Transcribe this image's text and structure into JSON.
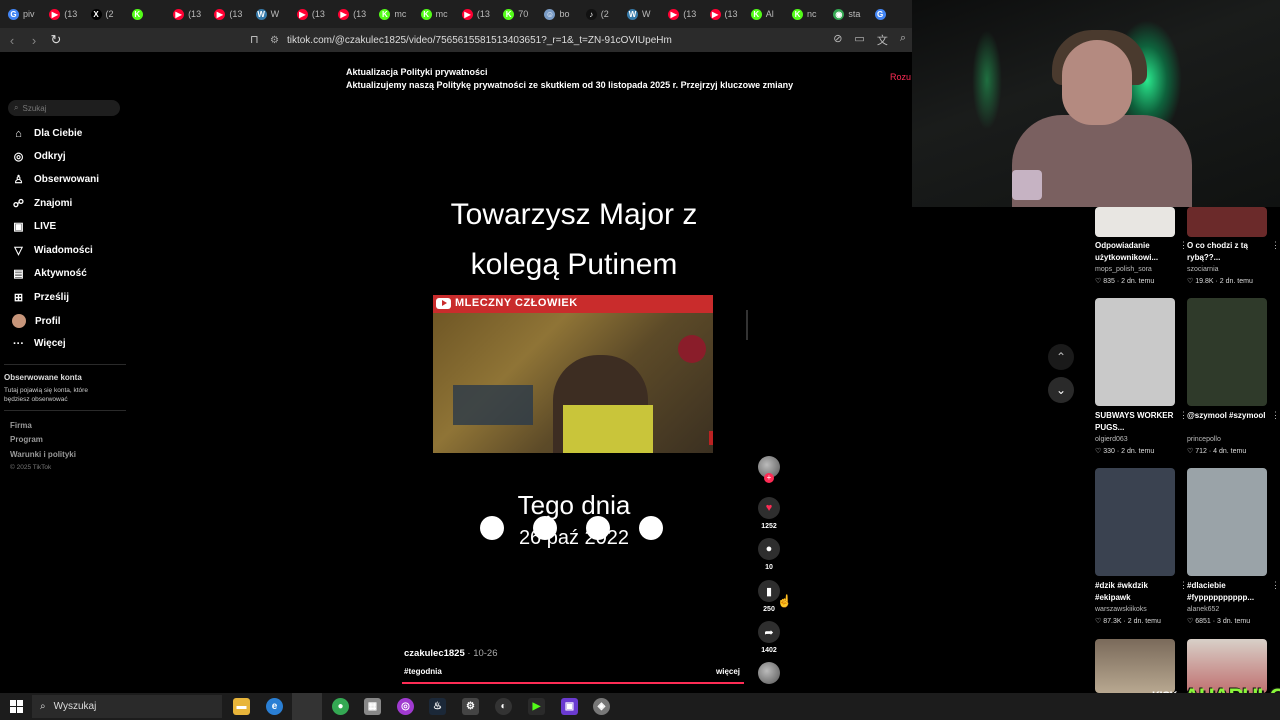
{
  "browser": {
    "tabs": [
      {
        "icon": "google-icon",
        "label": "piv",
        "color": "#4285f4",
        "glyph": "G"
      },
      {
        "icon": "youtube-icon",
        "label": "(13",
        "color": "#ff0033",
        "glyph": "▶"
      },
      {
        "icon": "x-icon",
        "label": "(2",
        "color": "#000000",
        "glyph": "X"
      },
      {
        "icon": "kick-icon",
        "label": "",
        "color": "#53fc18",
        "glyph": "K"
      },
      {
        "icon": "youtube-icon",
        "label": "(13",
        "color": "#ff0033",
        "glyph": "▶"
      },
      {
        "icon": "youtube-icon",
        "label": "(13",
        "color": "#ff0033",
        "glyph": "▶"
      },
      {
        "icon": "wykop-icon",
        "label": "W",
        "color": "#367aa9",
        "glyph": "W"
      },
      {
        "icon": "youtube-icon",
        "label": "(13",
        "color": "#ff0033",
        "glyph": "▶"
      },
      {
        "icon": "youtube-icon",
        "label": "(13",
        "color": "#ff0033",
        "glyph": "▶"
      },
      {
        "icon": "kick-icon",
        "label": "mc",
        "color": "#53fc18",
        "glyph": "K"
      },
      {
        "icon": "kick-icon",
        "label": "mc",
        "color": "#53fc18",
        "glyph": "K"
      },
      {
        "icon": "youtube-icon",
        "label": "(13",
        "color": "#ff0033",
        "glyph": "▶"
      },
      {
        "icon": "kick-icon",
        "label": "70",
        "color": "#53fc18",
        "glyph": "K"
      },
      {
        "icon": "bot-icon",
        "label": "bo",
        "color": "#7a9cc6",
        "glyph": "☺"
      },
      {
        "icon": "tiktok-icon",
        "label": "(2",
        "color": "#111111",
        "glyph": "♪"
      },
      {
        "icon": "wykop-icon",
        "label": "W",
        "color": "#367aa9",
        "glyph": "W"
      },
      {
        "icon": "youtube-icon",
        "label": "(13",
        "color": "#ff0033",
        "glyph": "▶"
      },
      {
        "icon": "youtube-icon",
        "label": "(13",
        "color": "#ff0033",
        "glyph": "▶"
      },
      {
        "icon": "kick-icon",
        "label": "Al",
        "color": "#53fc18",
        "glyph": "K"
      },
      {
        "icon": "kick-icon",
        "label": "nc",
        "color": "#53fc18",
        "glyph": "K"
      },
      {
        "icon": "maps-icon",
        "label": "sta",
        "color": "#34a853",
        "glyph": "◉"
      },
      {
        "icon": "google-icon",
        "label": "",
        "color": "#4285f4",
        "glyph": "G"
      }
    ],
    "url": "tiktok.com/@czakulec1825/video/7565615581513403651?_r=1&_t=ZN-91cOVIUpeHm"
  },
  "banner": {
    "title": "Aktualizacja Polityki prywatności",
    "text": "Aktualizujemy naszą Politykę prywatności ze skutkiem od 30 listopada 2025 r. Przejrzyj kluczowe zmiany",
    "button": "Rozu"
  },
  "sidebar": {
    "search_placeholder": "Szukaj",
    "items": [
      {
        "label": "Dla Ciebie",
        "icon": "home-icon",
        "glyph": "⌂"
      },
      {
        "label": "Odkryj",
        "icon": "compass-icon",
        "glyph": "◎"
      },
      {
        "label": "Obserwowani",
        "icon": "user-follow-icon",
        "glyph": "♙"
      },
      {
        "label": "Znajomi",
        "icon": "friends-icon",
        "glyph": "☍"
      },
      {
        "label": "LIVE",
        "icon": "live-icon",
        "glyph": "▣"
      },
      {
        "label": "Wiadomości",
        "icon": "send-icon",
        "glyph": "▽"
      },
      {
        "label": "Aktywność",
        "icon": "activity-icon",
        "glyph": "▤"
      },
      {
        "label": "Prześlij",
        "icon": "upload-icon",
        "glyph": "⊞"
      },
      {
        "label": "Profil",
        "icon": "avatar-icon",
        "glyph": ""
      },
      {
        "label": "Więcej",
        "icon": "more-icon",
        "glyph": "···"
      }
    ],
    "followed_title": "Obserwowane konta",
    "followed_desc": "Tutaj pojawią się konta, które będziesz obserwować",
    "footer_links": [
      "Firma",
      "Program",
      "Warunki i polityki"
    ],
    "copyright": "© 2025 TikTok"
  },
  "video": {
    "title_line1": "Towarzysz Major z",
    "title_line2": "kolegą Putinem",
    "still_channel": "MLECZNY CZŁOWIEK",
    "day_label": "Tego dnia",
    "date_label": "26 paź 2022",
    "author": "czakulec1825",
    "post_date": " · 10-26",
    "hashtag": "#tegodnia",
    "more": "więcej",
    "progress": 1.0
  },
  "actions": {
    "likes": "1252",
    "comments": "10",
    "saves": "250",
    "shares": "1402"
  },
  "grid": [
    {
      "title": "Odpowiadanie użytkownikowi...",
      "user": "mops_polish_sora",
      "likes": "835",
      "age": "2 dn. temu",
      "bg": "#e8e6e2"
    },
    {
      "title": "O co chodzi z tą rybą??...",
      "user": "szociarnia",
      "likes": "19.8K",
      "age": "2 dn. temu",
      "bg": "#6b2a2a"
    },
    {
      "title": "SUBWAYS WORKER PUGS...",
      "user": "olgierd063",
      "likes": "330",
      "age": "2 dn. temu",
      "bg": "#c9c9c9"
    },
    {
      "title": "@szymool #szymool",
      "user": "princepollo",
      "likes": "712",
      "age": "4 dn. temu",
      "bg": "#2f3a2a"
    },
    {
      "title": "#dzik #wkdzik #ekipawk",
      "user": "warszawskiikoks",
      "likes": "87.3K",
      "age": "2 dn. temu",
      "bg": "#3a4250"
    },
    {
      "title": "#dlaciebie #fypppppppppp...",
      "user": "alanek652",
      "likes": "6851",
      "age": "3 dn. temu",
      "bg": "#9aa3a8"
    }
  ],
  "overlay": {
    "kick_text": "KICK",
    "logo_text": "AHAPULCO"
  },
  "taskbar": {
    "search_placeholder": "Wyszukaj"
  },
  "colors": {
    "accent": "#fe2c55",
    "kick_green": "#53fc18"
  }
}
